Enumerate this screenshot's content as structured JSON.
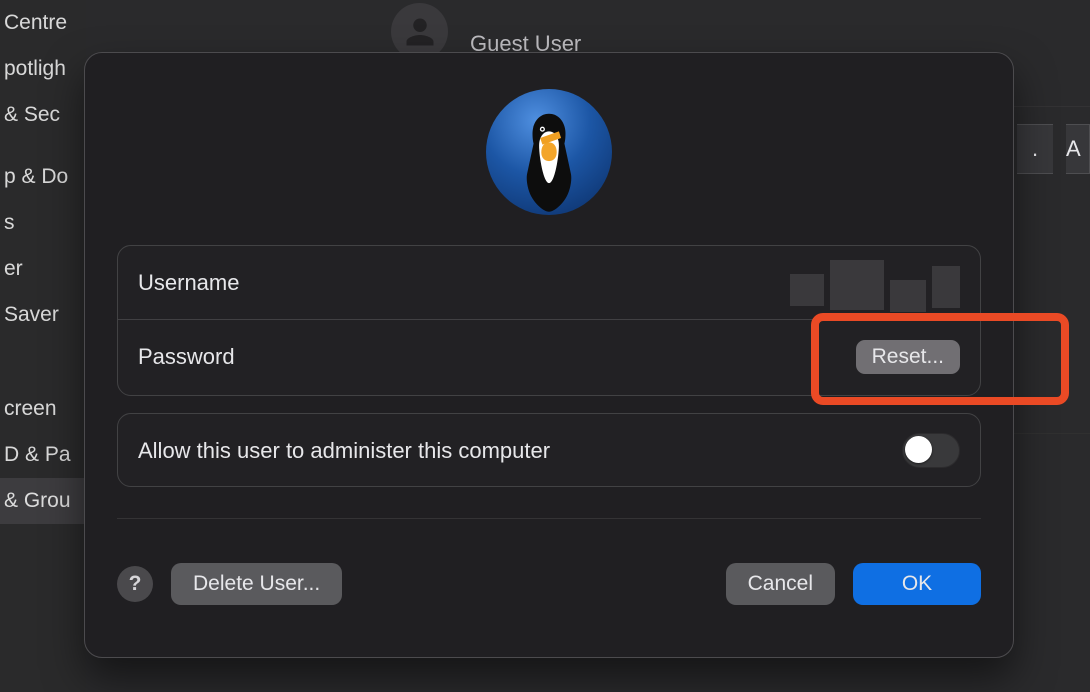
{
  "sidebar": {
    "items": [
      "Centre",
      "potligh",
      " & Sec",
      "p & Do",
      "s",
      "er",
      " Saver",
      "creen",
      "D & Pa",
      "& Grou"
    ]
  },
  "panel": {
    "guest_user": "Guest User",
    "cut_a": "A"
  },
  "sheet": {
    "username_label": "Username",
    "password_label": "Password",
    "reset_label": "Reset...",
    "admin_label": "Allow this user to administer this computer",
    "delete_label": "Delete User...",
    "cancel_label": "Cancel",
    "ok_label": "OK",
    "help_label": "?"
  }
}
